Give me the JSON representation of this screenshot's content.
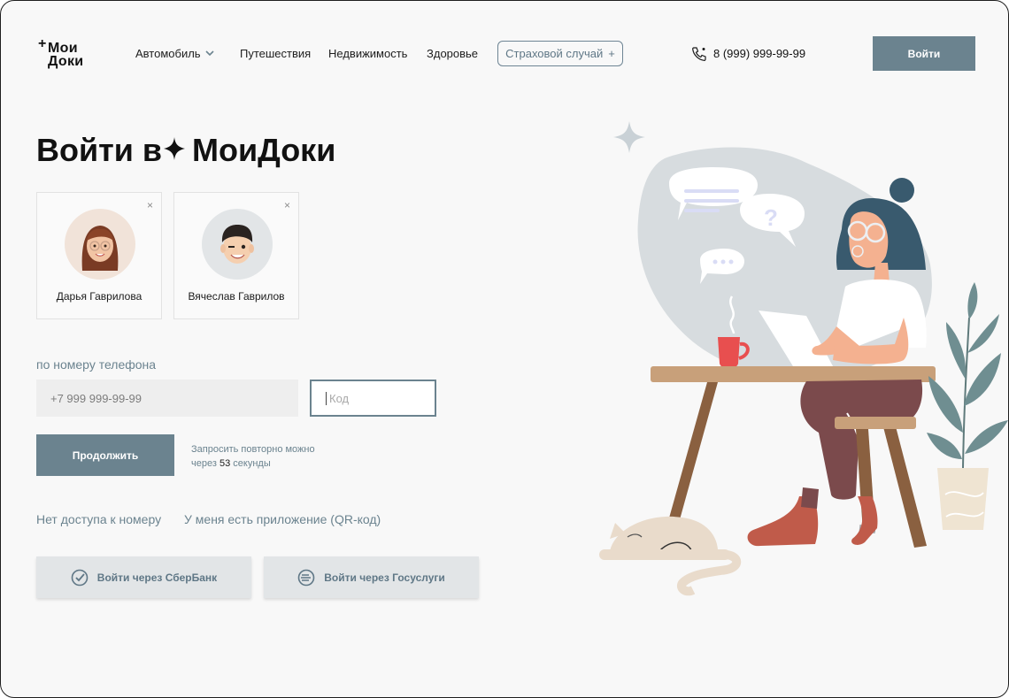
{
  "header": {
    "logo": {
      "line1": "Мои",
      "line2": "Доки"
    },
    "nav": [
      "Автомобиль",
      "Путешествия",
      "Недвижимость",
      "Здоровье"
    ],
    "claim_button": "Страховой случай",
    "claim_button_icon": "+",
    "phone": "8 (999) 999-99-99",
    "login_button": "Войти"
  },
  "login": {
    "title_prefix": "Войти в",
    "title_brand": "МоиДоки",
    "accounts": [
      {
        "name": "Дарья Гаврилова",
        "close": "×",
        "avatar_bg": "#f1e3d9"
      },
      {
        "name": "Вячеслав Гаврилов",
        "close": "×",
        "avatar_bg": "#e2e5e7"
      }
    ],
    "method_label": "по номеру телефона",
    "phone_placeholder": "+7 999 999-99-99",
    "code_placeholder": "Код",
    "continue_button": "Продолжить",
    "resend_line1": "Запросить повторно можно",
    "resend_prefix": "через",
    "resend_seconds": "53",
    "resend_suffix": "секунды",
    "no_access_link": "Нет доступа к номеру",
    "qr_link": "У меня есть приложение (QR-код)",
    "sber_button": "Войти через СберБанк",
    "gosuslugi_button": "Войти через Госуслуги"
  },
  "colors": {
    "accent": "#6b838f",
    "background": "#f8f8f8",
    "blob": "#d7dcdf",
    "cup": "#e84f4f"
  }
}
